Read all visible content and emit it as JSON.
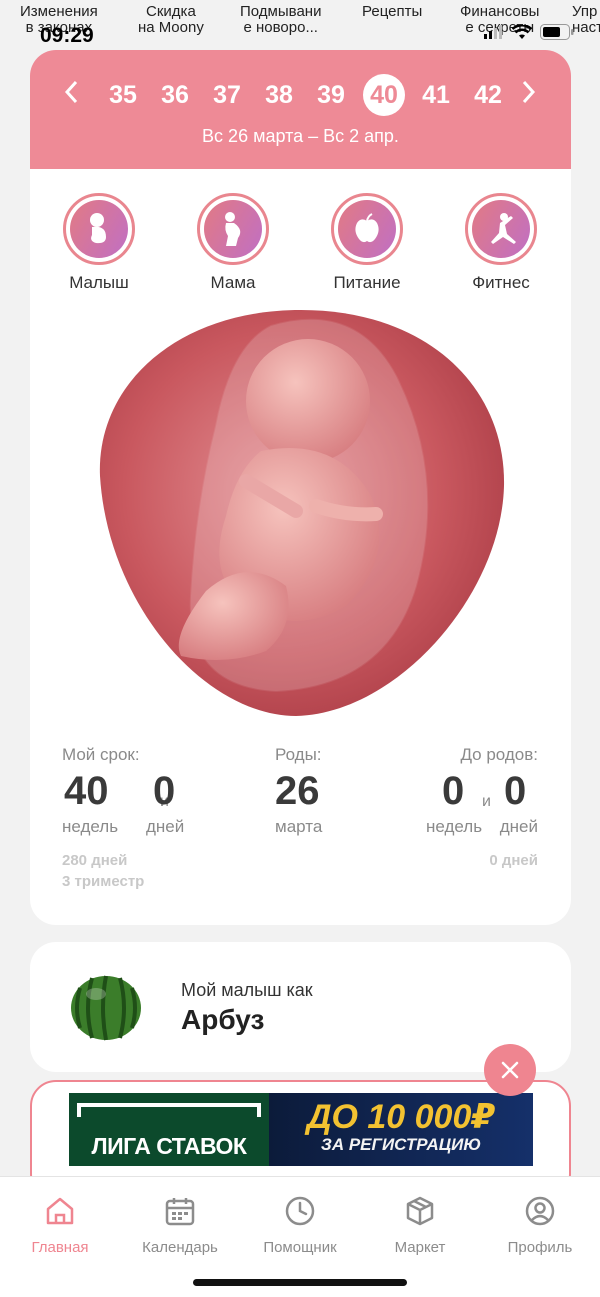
{
  "status": {
    "time": "09:29"
  },
  "stories": [
    {
      "line1": "Изменения",
      "line2": "в законах"
    },
    {
      "line1": "Скидка",
      "line2": "на Moony"
    },
    {
      "line1": "Подмывани",
      "line2": "е новоро..."
    },
    {
      "line1": "Рецепты",
      "line2": ""
    },
    {
      "line1": "Финансовы",
      "line2": "е секреты"
    },
    {
      "line1": "Упр",
      "line2": "наст"
    }
  ],
  "weeks": {
    "items": [
      "35",
      "36",
      "37",
      "38",
      "39",
      "40",
      "41",
      "42"
    ],
    "active": "40",
    "range": "Вс 26 марта – Вс 2 апр."
  },
  "categories": [
    {
      "label": "Малыш",
      "icon": "baby-icon"
    },
    {
      "label": "Мама",
      "icon": "mother-icon"
    },
    {
      "label": "Питание",
      "icon": "apple-icon"
    },
    {
      "label": "Фитнес",
      "icon": "fitness-icon"
    }
  ],
  "stats": {
    "term_label": "Мой срок:",
    "term_weeks": "40",
    "term_and": "и",
    "term_days": "0",
    "weeks_unit": "недель",
    "days_unit": "дней",
    "term_total": "280 дней",
    "trimester": "3 триместр",
    "birth_label": "Роды:",
    "birth_day": "26",
    "birth_month": "марта",
    "left_label": "До родов:",
    "left_weeks": "0",
    "left_and": "и",
    "left_days": "0",
    "left_total": "0 дней"
  },
  "fruit": {
    "subtitle": "Мой малыш как",
    "name": "Арбуз"
  },
  "ad": {
    "brand": "ЛИГА СТАВОК",
    "amount": "ДО 10 000₽",
    "tagline": "ЗА РЕГИСТРАЦИЮ"
  },
  "tabs": [
    {
      "label": "Главная",
      "icon": "home-icon",
      "active": true
    },
    {
      "label": "Календарь",
      "icon": "calendar-icon",
      "active": false
    },
    {
      "label": "Помощник",
      "icon": "clock-icon",
      "active": false
    },
    {
      "label": "Маркет",
      "icon": "box-icon",
      "active": false
    },
    {
      "label": "Профиль",
      "icon": "profile-icon",
      "active": false
    }
  ],
  "colors": {
    "accent": "#ee8a96",
    "active_tab": "#ef8590"
  }
}
